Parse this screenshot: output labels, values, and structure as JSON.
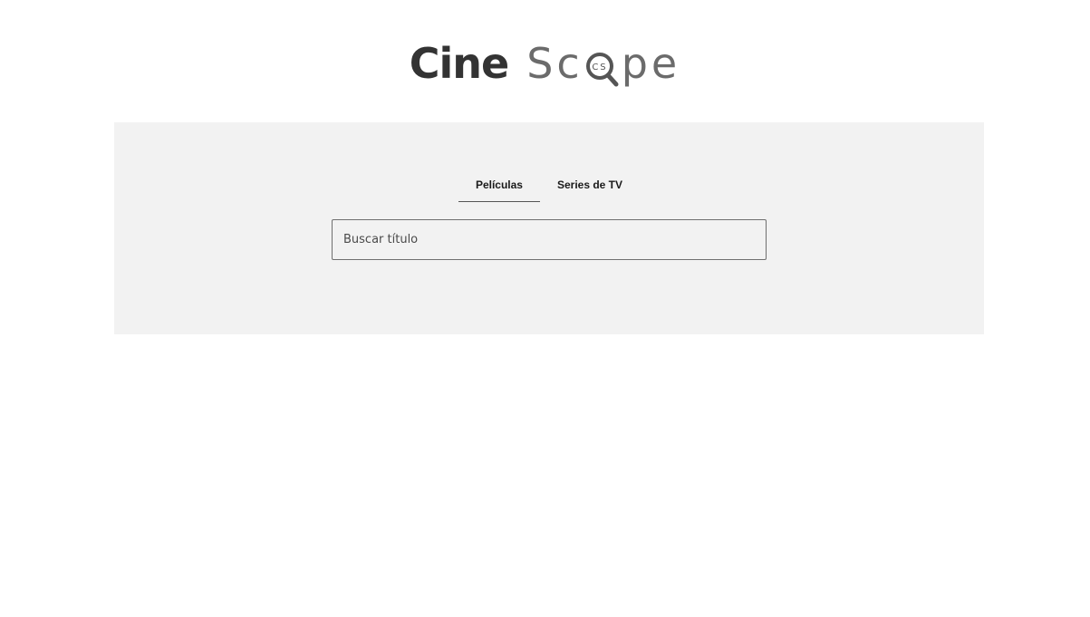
{
  "logo": {
    "word_bold": "Cine",
    "word_light_start": "Sc",
    "word_light_end": "pe",
    "magnifier_text": "CS",
    "magnifier_icon": "magnifier-icon",
    "colors": {
      "bold": "#333333",
      "light": "#6b6b6b"
    }
  },
  "tabs": [
    {
      "label": "Películas",
      "active": true
    },
    {
      "label": "Series de TV",
      "active": false
    }
  ],
  "search": {
    "value": "",
    "placeholder": "Buscar título"
  },
  "colors": {
    "panel_background": "#f2f2f2",
    "page_background": "#ffffff"
  }
}
